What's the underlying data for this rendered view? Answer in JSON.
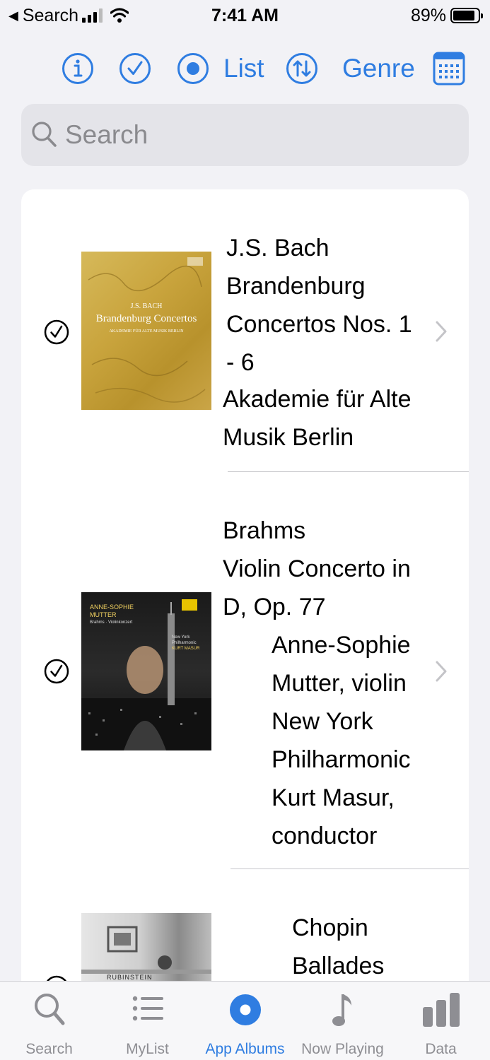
{
  "status_bar": {
    "back_label": "Search",
    "time": "7:41 AM",
    "battery": "89%",
    "battery_level": 0.89
  },
  "toolbar": {
    "info_icon": "info-icon",
    "check_icon": "checkmark-circle-icon",
    "radio_icon": "record-circle-icon",
    "list_label": "List",
    "sort_icon": "sort-arrows-icon",
    "genre_label": "Genre",
    "calendar_icon": "calendar-icon",
    "accent": "#2f7de1"
  },
  "search": {
    "placeholder": "Search"
  },
  "albums": [
    {
      "title_lines": [
        "J.S. Bach",
        "Brandenburg",
        "Concertos Nos. 1",
        "- 6"
      ],
      "artist_lines": [
        "Akademie für Alte",
        "Musik Berlin"
      ],
      "cover_text": [
        "J.S. BACH",
        "Brandenburg Concertos",
        "AKADEMIE FÜR ALTE MUSIK BERLIN"
      ],
      "checked": true
    },
    {
      "title_lines": [
        "Brahms",
        "Violin Concerto in",
        "D, Op. 77"
      ],
      "artist_lines": [
        "Anne-Sophie",
        "Mutter, violin",
        "New York",
        "Philharmonic",
        "Kurt Masur,",
        "conductor"
      ],
      "cover_text": [
        "ANNE-SOPHIE",
        "MUTTER",
        "Brahms · Violinkonzert",
        "New York Philharmonic",
        "KURT MASUR"
      ],
      "checked": true
    },
    {
      "title_lines": [
        "Chopin",
        "Ballades"
      ],
      "artist_lines": [],
      "cover_text": [
        "RUBINSTEIN"
      ],
      "checked": true
    }
  ],
  "tab_bar": {
    "tabs": [
      {
        "label": "Search",
        "icon": "magnifier-icon"
      },
      {
        "label": "MyList",
        "icon": "list-icon"
      },
      {
        "label": "App Albums",
        "icon": "album-disc-icon",
        "active": true
      },
      {
        "label": "Now Playing",
        "icon": "music-note-icon"
      },
      {
        "label": "Data",
        "icon": "bar-chart-icon"
      }
    ]
  }
}
